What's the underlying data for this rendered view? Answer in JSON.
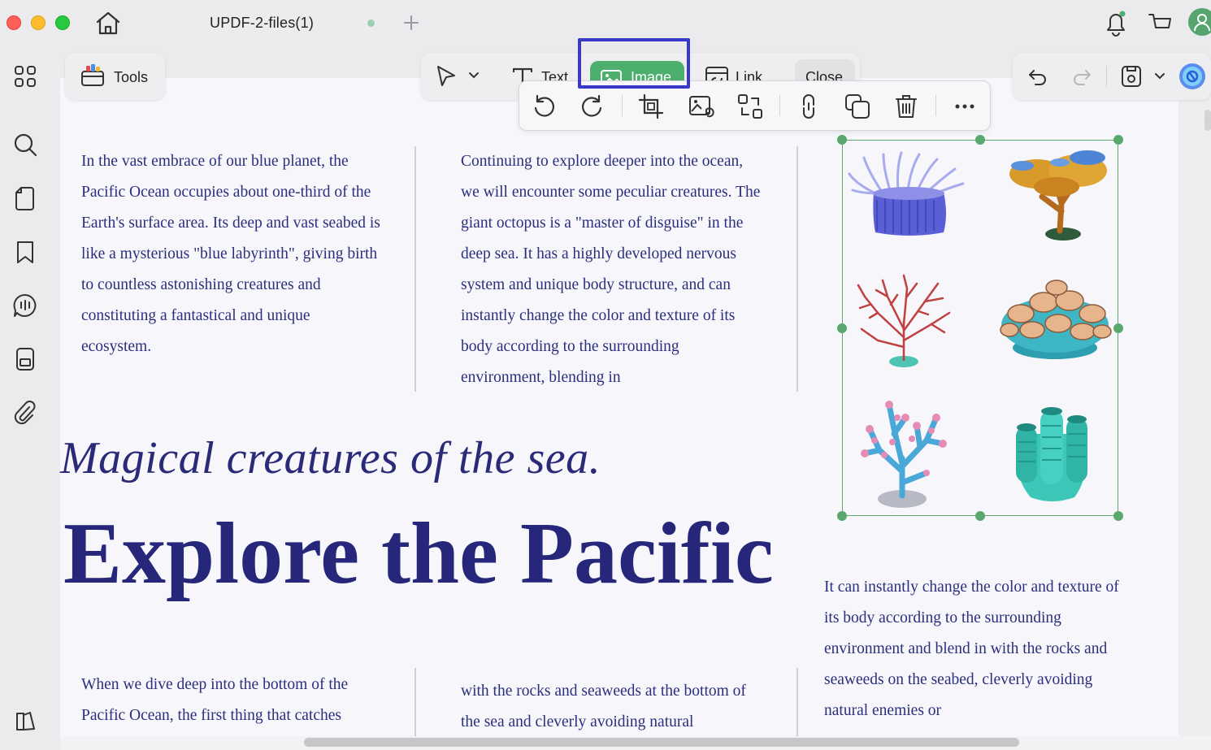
{
  "titlebar": {
    "tab_title": "UPDF-2-files(1)"
  },
  "toolbar": {
    "tools_label": "Tools",
    "text_label": "Text",
    "image_label": "Image",
    "link_label": "Link",
    "close_label": "Close"
  },
  "image_toolbar": {
    "icons": [
      "rotate-left-icon",
      "rotate-right-icon",
      "crop-icon",
      "replace-image-icon",
      "extract-image-icon",
      "link-image-icon",
      "duplicate-icon",
      "delete-icon",
      "more-icon"
    ]
  },
  "document": {
    "col1_top": "In the vast embrace of our blue planet, the Pacific Ocean occupies about one-third of the Earth's surface area. Its deep and vast seabed is like a mysterious \"blue labyrinth\", giving birth to countless astonishing creatures and constituting a fantastical and unique ecosystem.",
    "col2_top": "Continuing to explore deeper into the ocean, we will encounter some peculiar creatures. The giant octopus is a \"master of disguise\" in the deep sea. It has a highly developed nervous system and unique body structure, and can instantly change the color and texture of its body according to the surrounding environment, blending in",
    "subtitle": "Magical creatures of the sea.",
    "headline": "Explore the Pacific",
    "col3_bottom": "It can instantly change the color and texture of its body according to the surrounding environment and blend in with the rocks and seaweeds on the seabed, cleverly avoiding natural enemies or",
    "col1_bottom": "When we dive deep into the bottom of the Pacific Ocean, the first thing that catches",
    "col2_bottom": "with the rocks and seaweeds at the bottom of the sea and cleverly avoiding natural"
  },
  "colors": {
    "text_blue": "#2b2f7c",
    "selection_green": "#5aa86e",
    "image_tool_green": "#4caf6e",
    "highlight_box": "#3739c9"
  }
}
